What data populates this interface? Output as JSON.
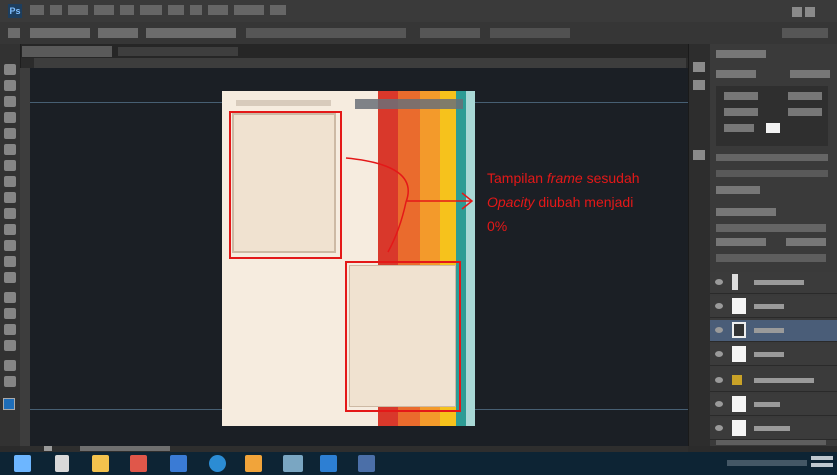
{
  "annotation": {
    "line1_pre": "Tampilan ",
    "line1_em": "frame",
    "line1_post": " sesudah",
    "line2_em": "Opacity",
    "line2_post": " diubah menjadi",
    "line3": "0%"
  },
  "app": {
    "logo": "Ps"
  },
  "colors": {
    "annotation_red": "#e41818",
    "document_bg": "#f6ecdf",
    "stripes": [
      "#d9382b",
      "#ea6b2d",
      "#f39a2b",
      "#f6c21c",
      "#2d9c95",
      "#a9d8d6"
    ]
  },
  "taskbar": {
    "icons": [
      "start-icon",
      "task-view-icon",
      "file-explorer-icon",
      "store-icon",
      "media-player-icon",
      "mail-icon",
      "edge-icon",
      "office-icon",
      "photos-icon",
      "photoshop-icon",
      "photoshop-icon-2"
    ]
  }
}
